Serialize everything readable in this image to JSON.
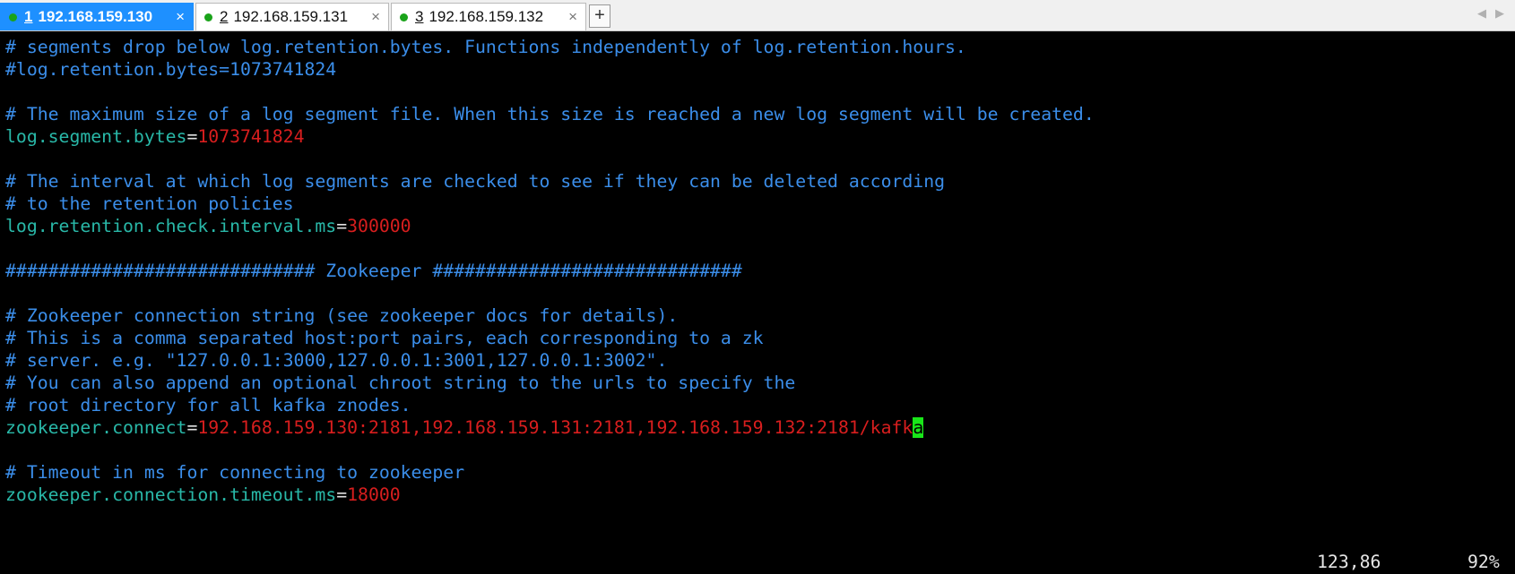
{
  "tabs": [
    {
      "number": "1",
      "label": "192.168.159.130",
      "active": true
    },
    {
      "number": "2",
      "label": "192.168.159.131",
      "active": false
    },
    {
      "number": "3",
      "label": "192.168.159.132",
      "active": false
    }
  ],
  "tab_close_glyph": "×",
  "new_tab_glyph": "+",
  "nav_glyphs": {
    "left": "◀",
    "right": "▶"
  },
  "colors": {
    "comment": "#3b8eea",
    "key": "#29b8a8",
    "value": "#d81e1e",
    "cursor": "#19e619",
    "active_tab": "#1e90ff",
    "status_dot": "#1aa31a",
    "background": "#000000"
  },
  "editor": {
    "comment_1": "# segments drop below log.retention.bytes. Functions independently of log.retention.hours.",
    "comment_2": "#log.retention.bytes=1073741824",
    "comment_3": "# The maximum size of a log segment file. When this size is reached a new log segment will be created.",
    "segment_key": "log.segment.bytes",
    "segment_value": "1073741824",
    "comment_4": "# The interval at which log segments are checked to see if they can be deleted according",
    "comment_5": "# to the retention policies",
    "interval_key": "log.retention.check.interval.ms",
    "interval_value": "300000",
    "section_header": "############################# Zookeeper #############################",
    "comment_6": "# Zookeeper connection string (see zookeeper docs for details).",
    "comment_7": "# This is a comma separated host:port pairs, each corresponding to a zk",
    "comment_8": "# server. e.g. \"127.0.0.1:3000,127.0.0.1:3001,127.0.0.1:3002\".",
    "comment_9": "# You can also append an optional chroot string to the urls to specify the",
    "comment_10": "# root directory for all kafka znodes.",
    "connect_key": "zookeeper.connect",
    "connect_value": "192.168.159.130:2181,192.168.159.131:2181,192.168.159.132:2181/kafk",
    "connect_cursor_char": "a",
    "comment_11": "# Timeout in ms for connecting to zookeeper",
    "timeout_key": "zookeeper.connection.timeout.ms",
    "timeout_value": "18000",
    "equals": "="
  },
  "status": {
    "position": "123,86",
    "percent": "92%"
  }
}
